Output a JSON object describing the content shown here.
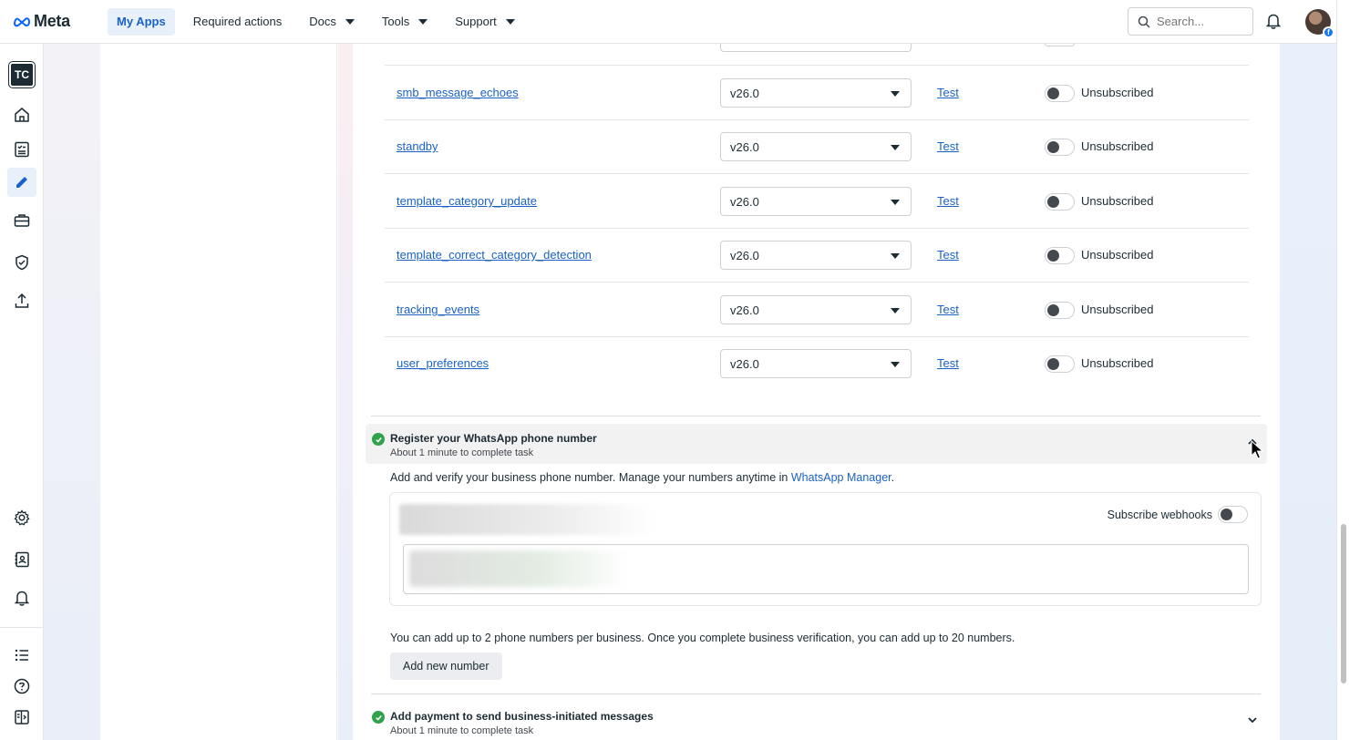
{
  "topbar": {
    "logo_text": "Meta",
    "nav": [
      {
        "label": "My Apps",
        "active": true,
        "dropdown": false
      },
      {
        "label": "Required actions",
        "active": false,
        "dropdown": false
      },
      {
        "label": "Docs",
        "active": false,
        "dropdown": true
      },
      {
        "label": "Tools",
        "active": false,
        "dropdown": true
      },
      {
        "label": "Support",
        "active": false,
        "dropdown": true
      }
    ],
    "search_placeholder": "Search..."
  },
  "rail": {
    "app_initials": "TC"
  },
  "webhook_fields": [
    {
      "field": "smb_message_echoes",
      "version": "v26.0",
      "test_label": "Test",
      "status": "Unsubscribed"
    },
    {
      "field": "standby",
      "version": "v26.0",
      "test_label": "Test",
      "status": "Unsubscribed"
    },
    {
      "field": "template_category_update",
      "version": "v26.0",
      "test_label": "Test",
      "status": "Unsubscribed"
    },
    {
      "field": "template_correct_category_detection",
      "version": "v26.0",
      "test_label": "Test",
      "status": "Unsubscribed"
    },
    {
      "field": "tracking_events",
      "version": "v26.0",
      "test_label": "Test",
      "status": "Unsubscribed"
    },
    {
      "field": "user_preferences",
      "version": "v26.0",
      "test_label": "Test",
      "status": "Unsubscribed"
    }
  ],
  "register_step": {
    "title": "Register your WhatsApp phone number",
    "subtitle": "About 1 minute to complete task",
    "description_prefix": "Add and verify your business phone number. Manage your numbers anytime in ",
    "description_link": "WhatsApp Manager",
    "description_suffix": ".",
    "subscribe_webhooks_label": "Subscribe webhooks",
    "limit_note": "You can add up to 2 phone numbers per business. Once you complete business verification, you can add up to 20 numbers.",
    "add_button": "Add new number"
  },
  "payment_step": {
    "title": "Add payment to send business-initiated messages",
    "subtitle": "About 1 minute to complete task"
  },
  "colors": {
    "link": "#1a62c7",
    "success": "#31a24c",
    "nav_active_bg": "#e7f0fb"
  }
}
